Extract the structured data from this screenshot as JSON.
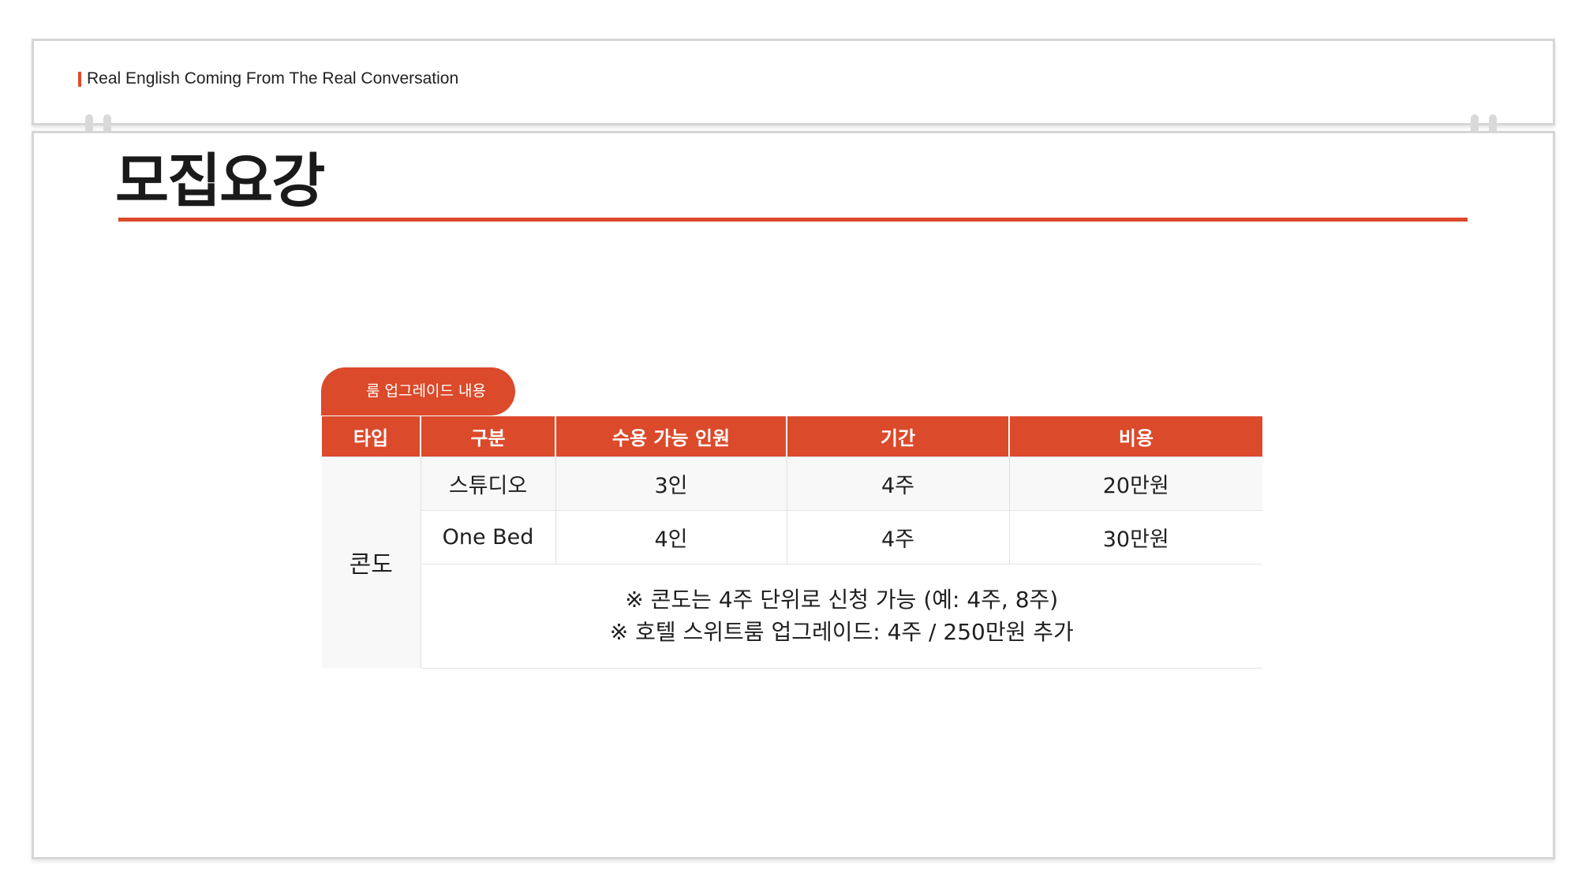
{
  "header": {
    "tagline": "Real English Coming From The Real Conversation"
  },
  "page": {
    "title": "모집요강"
  },
  "room_upgrade": {
    "tab_label": "룸 업그레이드 내용",
    "columns": [
      "타입",
      "구분",
      "수용 가능 인원",
      "기간",
      "비용"
    ],
    "type": "콘도",
    "rows": [
      {
        "category": "스튜디오",
        "capacity": "3인",
        "period": "4주",
        "cost": "20만원"
      },
      {
        "category": "One Bed",
        "capacity": "4인",
        "period": "4주",
        "cost": "30만원"
      }
    ],
    "notes": [
      "※ 콘도는 4주 단위로 신청 가능 (예: 4주, 8주)",
      "※ 호텔 스위트룸 업그레이드: 4주 / 250만원 추가"
    ]
  },
  "colors": {
    "accent": "#db4a2b",
    "card_border": "#d6d6d6",
    "row_alt": "#f8f8f8"
  }
}
